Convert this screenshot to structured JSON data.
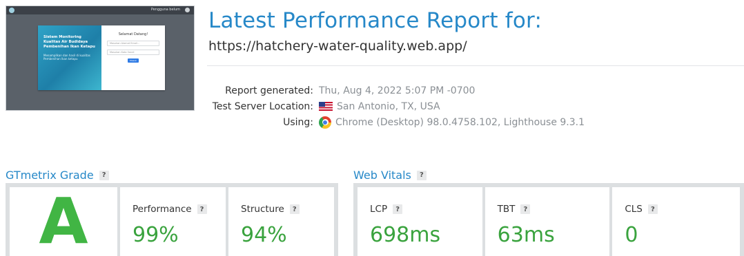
{
  "thumbnail": {
    "topbar_text": "Pengguna belum",
    "card_title": "Sistem Monitoring\nKualitas Air Budidaya\nPembenihan Ikan Ketapu",
    "card_subtitle": "Menampilkan dan hasil di kualitas\nPembenihan Ikan ketapu",
    "form_heading": "Selamat Datang!",
    "email_placeholder": "Masukan Alamat Email...",
    "password_placeholder": "Masukan Kata Sandi",
    "login_button": "Masuk"
  },
  "header": {
    "title": "Latest Performance Report for:",
    "url": "https://hatchery-water-quality.web.app/"
  },
  "meta": {
    "report_generated_label": "Report generated:",
    "report_generated_value": "Thu, Aug 4, 2022 5:07 PM -0700",
    "server_location_label": "Test Server Location:",
    "server_location_value": "San Antonio, TX, USA",
    "using_label": "Using:",
    "using_value": "Chrome (Desktop) 98.0.4758.102, Lighthouse 9.3.1"
  },
  "gtmetrix": {
    "title": "GTmetrix Grade",
    "help": "?",
    "grade": "A",
    "performance_label": "Performance",
    "performance_value": "99%",
    "structure_label": "Structure",
    "structure_value": "94%"
  },
  "web_vitals": {
    "title": "Web Vitals",
    "help": "?",
    "lcp_label": "LCP",
    "lcp_value": "698ms",
    "tbt_label": "TBT",
    "tbt_value": "63ms",
    "cls_label": "CLS",
    "cls_value": "0"
  },
  "colors": {
    "accent_blue": "#2688c8",
    "grade_green": "#41b544",
    "value_green": "#3aa33e",
    "box_border": "#dcdfe1"
  },
  "icons": [
    "us-flag-icon",
    "chrome-icon",
    "help-icon"
  ]
}
